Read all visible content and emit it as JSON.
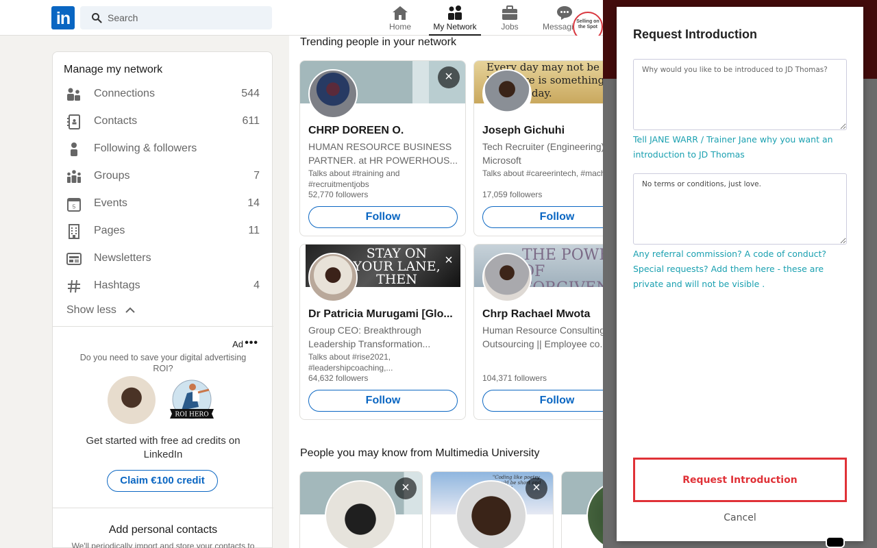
{
  "topnav": {
    "logo": "in",
    "search_placeholder": "Search",
    "items": [
      {
        "label": "Home",
        "icon": "home-icon"
      },
      {
        "label": "My Network",
        "icon": "network-icon",
        "active": true
      },
      {
        "label": "Jobs",
        "icon": "briefcase-icon"
      },
      {
        "label": "Messaging",
        "icon": "message-icon"
      }
    ],
    "extension_badge": "Selling on the Spot"
  },
  "sidebar": {
    "title": "Manage my network",
    "items": [
      {
        "label": "Connections",
        "count": "544",
        "icon": "connections-icon"
      },
      {
        "label": "Contacts",
        "count": "611",
        "icon": "contacts-icon"
      },
      {
        "label": "Following & followers",
        "count": "",
        "icon": "person-icon"
      },
      {
        "label": "Groups",
        "count": "7",
        "icon": "groups-icon"
      },
      {
        "label": "Events",
        "count": "14",
        "icon": "calendar-icon"
      },
      {
        "label": "Pages",
        "count": "11",
        "icon": "building-icon"
      },
      {
        "label": "Newsletters",
        "count": "",
        "icon": "newsletter-icon"
      },
      {
        "label": "Hashtags",
        "count": "4",
        "icon": "hashtag-icon"
      }
    ],
    "show_less": "Show less",
    "ad": {
      "label": "Ad",
      "more": "•••",
      "question": "Do you need to save your digital advertising ROI?",
      "badge_text": "ROI HERO",
      "body": "Get started with free ad credits on LinkedIn",
      "cta": "Claim €100 credit"
    },
    "add_contacts": {
      "title": "Add personal contacts",
      "subtitle": "We'll periodically import and store your contacts to"
    }
  },
  "main": {
    "trending_title": "Trending people in your network",
    "trending": [
      {
        "name": "CHRP DOREEN O.",
        "headline": "HUMAN RESOURCE BUSINESS PARTNER. at HR POWERHOUS...",
        "talks": "Talks about #training and #recruitmentjobs",
        "followers": "52,770 followers",
        "follow": "Follow",
        "dismiss": "×"
      },
      {
        "name": "Joseph Gichuhi",
        "headline": "Tech Recruiter (Engineering) Microsoft",
        "talks": "Talks about #careerintech, #machinelearning, #techrecruiting",
        "followers": "17,059 followers",
        "follow": "Follow",
        "banner_text": "Every day may not be good, but there is something good in every day."
      },
      {
        "name": "Dr Patricia Murugami [Glo...",
        "headline": "Group CEO: Breakthrough Leadership Transformation...",
        "talks": "Talks about #rise2021, #leadershipcoaching,...",
        "followers": "64,632 followers",
        "follow": "Follow",
        "dismiss": "×",
        "banner_text": "STAY ON YOUR LANE, THEN EXPAND IT."
      },
      {
        "name": "Chrp Rachael Mwota",
        "headline": "Human Resource Consulting | Outsourcing || Employee co...",
        "talks": "",
        "followers": "104,371 followers",
        "follow": "Follow",
        "banner_text": "THE POWER OF FORGIVENESS"
      }
    ],
    "pymk_title": "People you may know from Multimedia University",
    "pymk": [
      {
        "dismiss": "×"
      },
      {
        "dismiss": "×",
        "banner_text": "\"Coding like poetry should be short and concise\""
      },
      {}
    ]
  },
  "modal": {
    "title": "Request Introduction",
    "reason_placeholder": "Why would you like to be introduced to JD Thomas?",
    "reason_value": "",
    "reason_hint": "Tell JANE WARR / Trainer Jane why you want an introduction to JD Thomas",
    "terms_value": "No terms or conditions, just love.",
    "terms_hint": "Any referral commission? A code of conduct? Special requests? Add them here - these are private and will not be visible .",
    "submit": "Request Introduction",
    "cancel": "Cancel"
  },
  "colors": {
    "linkedin_blue": "#0a66c2",
    "accent_red": "#e03137",
    "hint_teal": "#1aa0b0"
  }
}
